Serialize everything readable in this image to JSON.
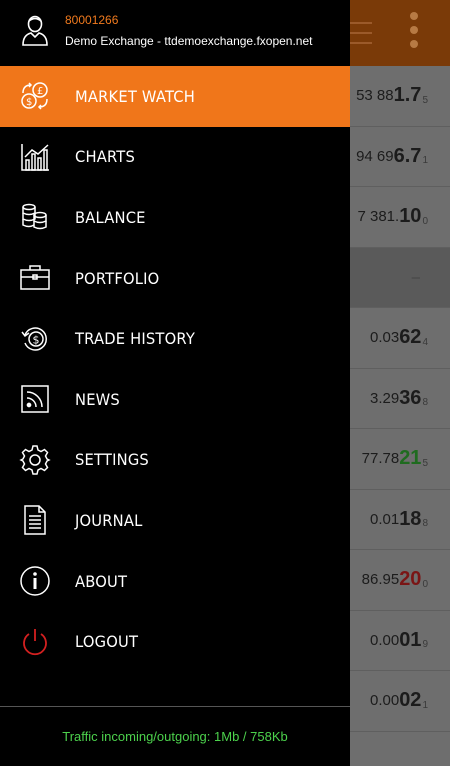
{
  "account": {
    "id": "80001266",
    "server": "Demo Exchange - ttdemoexchange.fxopen.net"
  },
  "menu": [
    {
      "label": "MARKET WATCH",
      "icon": "currency-exchange-icon",
      "active": true
    },
    {
      "label": "CHARTS",
      "icon": "chart-icon",
      "active": false
    },
    {
      "label": "BALANCE",
      "icon": "coins-icon",
      "active": false
    },
    {
      "label": "PORTFOLIO",
      "icon": "briefcase-icon",
      "active": false
    },
    {
      "label": "TRADE HISTORY",
      "icon": "history-icon",
      "active": false
    },
    {
      "label": "NEWS",
      "icon": "rss-icon",
      "active": false
    },
    {
      "label": "SETTINGS",
      "icon": "gear-icon",
      "active": false
    },
    {
      "label": "JOURNAL",
      "icon": "document-icon",
      "active": false
    },
    {
      "label": "ABOUT",
      "icon": "info-icon",
      "active": false
    },
    {
      "label": "LOGOUT",
      "icon": "power-icon",
      "active": false
    }
  ],
  "footer": {
    "traffic": "Traffic incoming/outgoing: 1Mb / 758Kb"
  },
  "background_quotes": [
    {
      "prefix": "53 88",
      "big": "1.7",
      "sup": "5",
      "color": ""
    },
    {
      "prefix": "94 69",
      "big": "6.7",
      "sup": "1",
      "color": ""
    },
    {
      "prefix": "7 381.",
      "big": "10",
      "sup": "0",
      "color": ""
    },
    {
      "section": true,
      "text": "–"
    },
    {
      "prefix": "0.03",
      "big": "62",
      "sup": "4",
      "color": ""
    },
    {
      "prefix": "3.29",
      "big": "36",
      "sup": "8",
      "color": ""
    },
    {
      "prefix": "77.78",
      "big": "21",
      "sup": "5",
      "color": "green"
    },
    {
      "prefix": "0.01",
      "big": "18",
      "sup": "8",
      "color": ""
    },
    {
      "prefix": "86.95",
      "big": "20",
      "sup": "0",
      "color": "red"
    },
    {
      "prefix": "0.00",
      "big": "01",
      "sup": "9",
      "color": ""
    },
    {
      "prefix": "0.00",
      "big": "02",
      "sup": "1",
      "color": ""
    }
  ],
  "colors": {
    "accent": "#f0761a",
    "account_id": "#f07a1e",
    "traffic_text": "#4cd14c"
  }
}
